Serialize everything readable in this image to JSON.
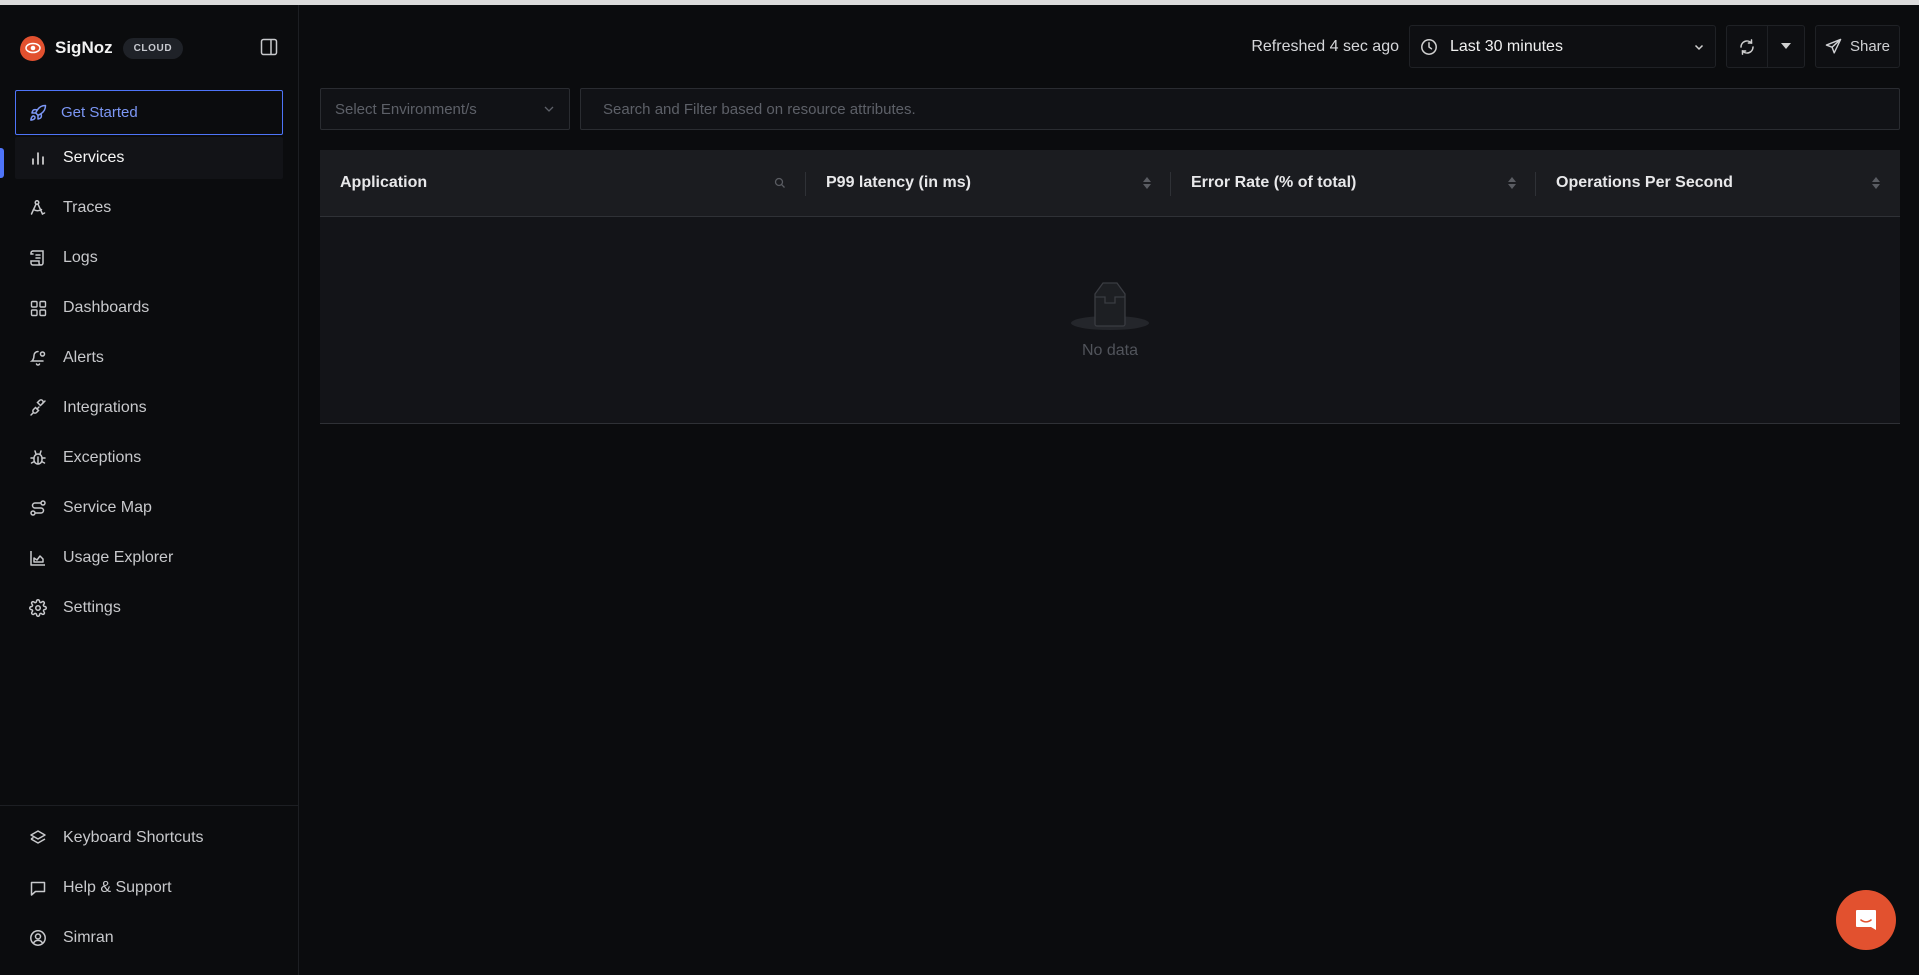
{
  "brand": {
    "name": "SigNoz",
    "badge": "CLOUD",
    "accent_color": "#e2512f"
  },
  "sidebar": {
    "get_started": {
      "label": "Get Started",
      "icon": "rocket-icon"
    },
    "items": [
      {
        "label": "Services",
        "icon": "bar-chart-icon",
        "active": true
      },
      {
        "label": "Traces",
        "icon": "traces-icon"
      },
      {
        "label": "Logs",
        "icon": "scroll-icon"
      },
      {
        "label": "Dashboards",
        "icon": "grid-icon"
      },
      {
        "label": "Alerts",
        "icon": "bell-icon"
      },
      {
        "label": "Integrations",
        "icon": "plug-icon"
      },
      {
        "label": "Exceptions",
        "icon": "bug-icon"
      },
      {
        "label": "Service Map",
        "icon": "route-icon"
      },
      {
        "label": "Usage Explorer",
        "icon": "area-chart-icon"
      },
      {
        "label": "Settings",
        "icon": "gear-icon"
      }
    ],
    "bottom_items": [
      {
        "label": "Keyboard Shortcuts",
        "icon": "layers-icon"
      },
      {
        "label": "Help & Support",
        "icon": "message-square-icon"
      },
      {
        "label": "Simran",
        "icon": "user-circle-icon"
      }
    ]
  },
  "topbar": {
    "refreshed_text": "Refreshed 4 sec ago",
    "time_range": "Last 30 minutes",
    "share_label": "Share"
  },
  "filters": {
    "environment_placeholder": "Select Environment/s",
    "search_placeholder": "Search and Filter based on resource attributes.",
    "search_value": ""
  },
  "table": {
    "columns": [
      {
        "label": "Application",
        "control": "search"
      },
      {
        "label": "P99 latency (in ms)",
        "control": "sort"
      },
      {
        "label": "Error Rate (% of total)",
        "control": "sort"
      },
      {
        "label": "Operations Per Second",
        "control": "sort"
      }
    ],
    "rows": [],
    "empty_text": "No data"
  },
  "colors": {
    "primary": "#4e74f8",
    "background": "#0b0c0e",
    "table_header": "#1b1c20",
    "table_body": "#131418"
  }
}
